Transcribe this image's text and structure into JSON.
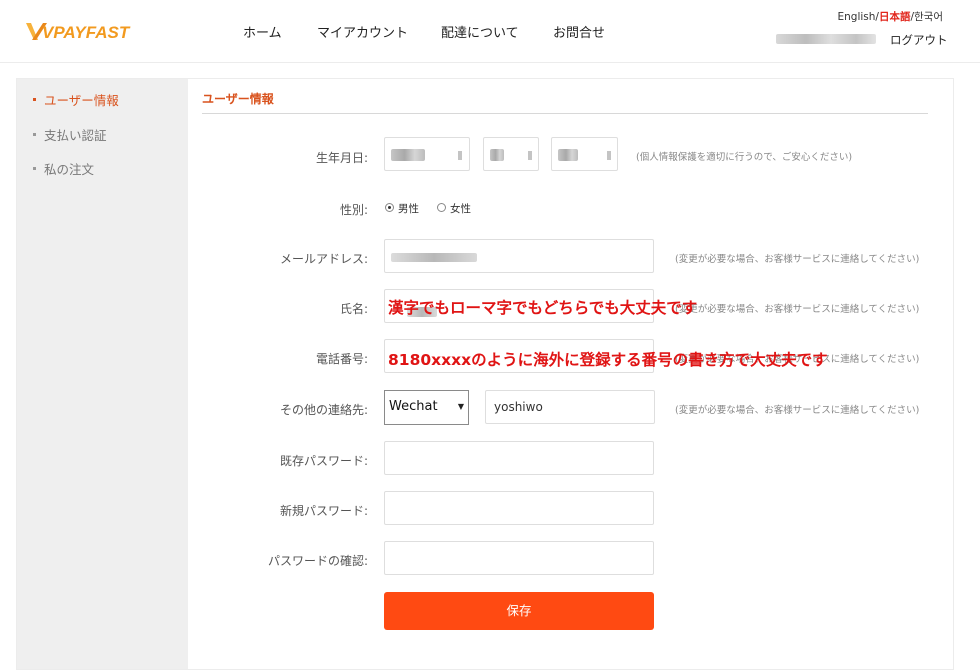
{
  "brand": {
    "logo": "VPAYFAST",
    "logo_color": "#f29a1f"
  },
  "nav": {
    "home": "ホーム",
    "account": "マイアカウント",
    "shipping": "配達について",
    "contact": "お問合せ"
  },
  "lang": {
    "english": "English",
    "sep1": "/",
    "japanese": "日本語",
    "sep2": "/",
    "korean": "한국어",
    "selected_color": "#e1251b"
  },
  "header": {
    "logout": "ログアウト"
  },
  "sidebar": {
    "items": [
      {
        "label": "ユーザー情報",
        "active": true
      },
      {
        "label": "支払い認証"
      },
      {
        "label": "私の注文"
      }
    ]
  },
  "form": {
    "title": "ユーザー情報",
    "birth": {
      "label": "生年月日:",
      "note": "(個人情報保護を適切に行うので、ご安心ください)"
    },
    "gender": {
      "label": "性別:",
      "male": "男性",
      "female": "女性",
      "selected": "男性"
    },
    "email": {
      "label": "メールアドレス:",
      "note": "(変更が必要な場合、お客様サービスに連絡してください)"
    },
    "name": {
      "label": "氏名:",
      "note": "(変更が必要な場合、お客様サービスに連絡してください)"
    },
    "phone": {
      "label": "電話番号:"
    },
    "other": {
      "label": "その他の連絡先:",
      "select_value": "Wechat",
      "value": "yoshiwo",
      "note": "(変更が必要な場合、お客様サービスに連絡してください)"
    },
    "old_pw": {
      "label": "既存パスワード:"
    },
    "new_pw": {
      "label": "新規パスワード:"
    },
    "confirm_pw": {
      "label": "パスワードの確認:"
    },
    "save": "保存"
  },
  "annotations": {
    "name": "漢字でもローマ字でもどちらでも大丈夫です",
    "phone": "8180xxxxのように海外に登録する番号の書き方で大丈夫です",
    "color": "#e01414"
  },
  "accent": "#d9531e",
  "button_color": "#ff4a12"
}
